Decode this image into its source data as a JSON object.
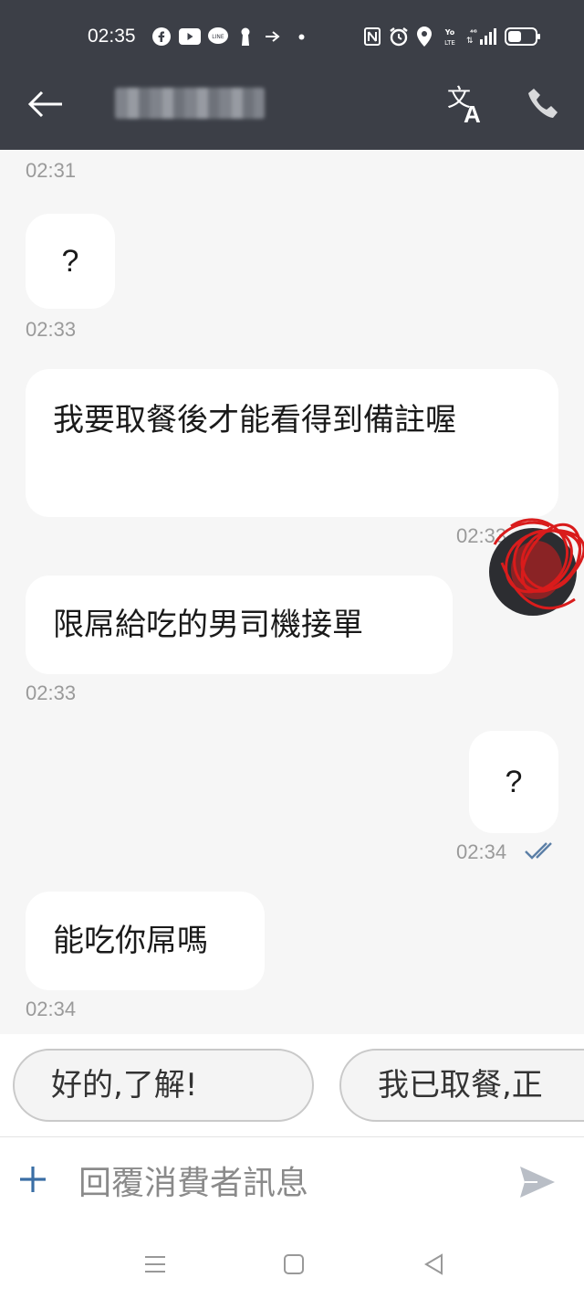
{
  "status_bar": {
    "time": "02:35",
    "icons": [
      "facebook-icon",
      "youtube-icon",
      "line-icon",
      "keyhole-icon",
      "gesture-icon",
      "dot-icon",
      "nfc-icon",
      "alarm-icon",
      "location-icon",
      "volte-icon",
      "signal-4g-icon",
      "battery-icon"
    ]
  },
  "header": {
    "back_icon": "arrow-left-icon",
    "translate_icon": "translate-icon",
    "phone_icon": "phone-icon"
  },
  "messages": [
    {
      "side": "incoming",
      "text": "?",
      "time": "02:33"
    },
    {
      "side": "incoming",
      "text": "我要取餐後才能看得到備註喔",
      "time": "02:33"
    },
    {
      "side": "incoming",
      "text": "限屌給吃的男司機接單",
      "time": "02:33"
    },
    {
      "side": "outgoing",
      "text": "?",
      "time": "02:34"
    },
    {
      "side": "incoming",
      "text": "能吃你屌嗎",
      "time": "02:34"
    }
  ],
  "top_timestamp": "02:31",
  "outgoing_ts_partial": "02:33",
  "quick_replies": [
    "好的,了解!",
    "我已取餐,正"
  ],
  "composer": {
    "placeholder": "回覆消費者訊息"
  },
  "colors": {
    "header_bg": "#3c3f47",
    "read_check": "#5b7fa6",
    "plus_accent": "#3a6ea5"
  }
}
